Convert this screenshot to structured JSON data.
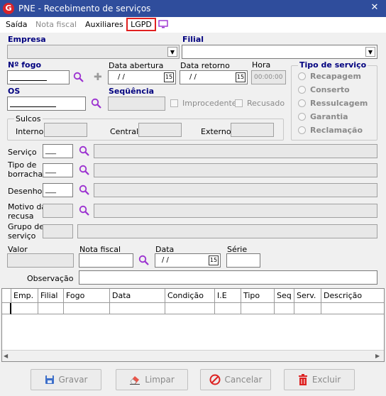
{
  "window": {
    "title": "PNE - Recebimento de serviços",
    "close": "✕"
  },
  "menu": {
    "items": [
      "Saída",
      "Nota fiscal",
      "Auxiliares",
      "LGPD"
    ]
  },
  "colors": {
    "titlebar": "#2f4d9c",
    "label_blue": "#00007f",
    "highlight": "#e02020",
    "monitor_icon": "#9b30d0"
  },
  "form": {
    "empresa_label": "Empresa",
    "filial_label": "Filial",
    "nfogo_label": "Nº  fogo",
    "data_abertura_label": "Data abertura",
    "data_abertura_value": " / /",
    "data_retorno_label": "Data retorno",
    "data_retorno_value": " / /",
    "hora_label": "Hora",
    "hora_value": "00:00:00",
    "os_label": "OS",
    "sequencia_label": "Seqüência",
    "improcedente_label": "Improcedente",
    "recusado_label": "Recusado",
    "calendar_day": "15",
    "tipo_servico": {
      "title": "Tipo de serviço",
      "options": [
        "Recapagem",
        "Conserto",
        "Ressulcagem",
        "Garantia",
        "Reclamação"
      ]
    },
    "sulcos": {
      "title": "Sulcos",
      "interno": "Interno",
      "central": "Central",
      "externo": "Externo"
    },
    "servico_label": "Serviço",
    "servico_value": "___",
    "tipo_borracha_label1": "Tipo de",
    "tipo_borracha_label2": "borracha",
    "tipo_borracha_value": "___",
    "desenho_label": "Desenho",
    "desenho_value": "___",
    "motivo_label1": "Motivo da",
    "motivo_label2": "recusa",
    "grupo_label1": "Grupo de",
    "grupo_label2": "serviço",
    "valor_label": "Valor",
    "nota_fiscal_label": "Nota fiscal",
    "data_label": "Data",
    "data_value": " / /",
    "serie_label": "Série",
    "observacao_label": "Observação"
  },
  "grid": {
    "columns": [
      "Emp.",
      "Filial",
      "Fogo",
      "Data",
      "Condição",
      "I.E",
      "Tipo",
      "Seq",
      "Serv.",
      "Descrição"
    ]
  },
  "buttons": {
    "gravar": "Gravar",
    "limpar": "Limpar",
    "cancelar": "Cancelar",
    "excluir": "Excluir"
  }
}
